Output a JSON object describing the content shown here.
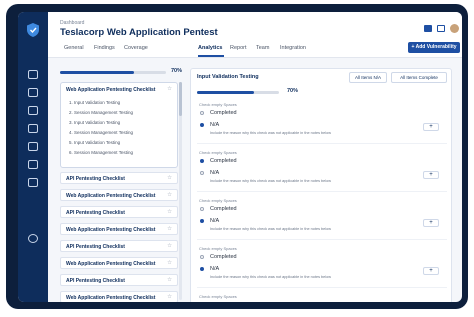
{
  "app": {
    "breadcrumb": "Dashboard",
    "title": "Teslacorp Web Application Pentest",
    "add_button": "+ Add Vulnerability"
  },
  "tabs": [
    {
      "label": "General"
    },
    {
      "label": "Findings"
    },
    {
      "label": "Coverage"
    },
    {
      "label": "Analytics"
    },
    {
      "label": "Report"
    },
    {
      "label": "Team"
    },
    {
      "label": "Integration"
    }
  ],
  "left_panel": {
    "progress_percent": 70,
    "progress_label": "70%",
    "open_checklist": {
      "title": "Web Application Pentesting Checklist",
      "items": [
        "1. Input Validation Testing",
        "2. Session Management Testing",
        "3. Input Validation Testing",
        "4. Session Management Testing",
        "5. Input Validation Testing",
        "6. Session Management Testing"
      ]
    },
    "checklists": [
      "API Pentesting Checklist",
      "Web Application Pentesting Checklist",
      "API Pentesting Checklist",
      "Web Application Pentesting Checklist",
      "API Pentesting Checklist",
      "Web Application Pentesting Checklist",
      "API Pentesting Checklist",
      "Web Application Pentesting Checklist"
    ]
  },
  "right_panel": {
    "section_title": "Input Validation Testing",
    "btn_all_na": "All Items N/A",
    "btn_all_complete": "All Items Complete",
    "progress_percent": 70,
    "progress_label": "70%",
    "group_label": "Check empty Spaces",
    "option_completed": "Completed",
    "option_na": "N/A",
    "note": "Include the reason why this check was not applicable in the notes below",
    "groups_count": 4
  },
  "colors": {
    "rail": "#0e2d5c",
    "accent": "#1e4fa3",
    "frame": "#0d1f3c"
  }
}
